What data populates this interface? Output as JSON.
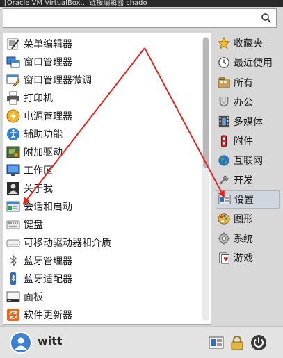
{
  "background_window": {
    "title": "[Oracle VM VirtualBox...  链接编辑器   shado"
  },
  "search": {
    "value": "",
    "placeholder": "",
    "icon": "search-icon"
  },
  "apps": [
    {
      "label": "菜单编辑器",
      "icon": "menu-editor-icon"
    },
    {
      "label": "窗口管理器",
      "icon": "window-manager-icon"
    },
    {
      "label": "窗口管理器微调",
      "icon": "window-tweaks-icon"
    },
    {
      "label": "打印机",
      "icon": "printer-icon"
    },
    {
      "label": "电源管理器",
      "icon": "power-manager-icon"
    },
    {
      "label": "辅助功能",
      "icon": "accessibility-icon"
    },
    {
      "label": "附加驱动",
      "icon": "additional-drivers-icon"
    },
    {
      "label": "工作区",
      "icon": "workspace-icon"
    },
    {
      "label": "关于我",
      "icon": "about-me-icon"
    },
    {
      "label": "会话和启动",
      "icon": "session-startup-icon"
    },
    {
      "label": "键盘",
      "icon": "keyboard-icon"
    },
    {
      "label": "可移动驱动器和介质",
      "icon": "removable-drives-icon"
    },
    {
      "label": "蓝牙管理器",
      "icon": "bluetooth-icon"
    },
    {
      "label": "蓝牙适配器",
      "icon": "bluetooth-adapter-icon"
    },
    {
      "label": "面板",
      "icon": "panel-icon"
    },
    {
      "label": "软件更新器",
      "icon": "software-updater-icon"
    }
  ],
  "categories": [
    {
      "label": "收藏夹",
      "icon": "star-icon"
    },
    {
      "label": "最近使用",
      "icon": "clock-icon"
    },
    {
      "label": "所有",
      "icon": "all-apps-icon"
    },
    {
      "label": "办公",
      "icon": "office-icon"
    },
    {
      "label": "多媒体",
      "icon": "multimedia-icon"
    },
    {
      "label": "附件",
      "icon": "accessories-icon"
    },
    {
      "label": "互联网",
      "icon": "internet-icon"
    },
    {
      "label": "开发",
      "icon": "development-icon"
    },
    {
      "label": "设置",
      "icon": "settings-icon",
      "selected": true
    },
    {
      "label": "图形",
      "icon": "graphics-icon"
    },
    {
      "label": "系统",
      "icon": "system-icon"
    },
    {
      "label": "游戏",
      "icon": "games-icon"
    }
  ],
  "user": {
    "name": "witt"
  },
  "bottom_buttons": [
    "settings-manager-icon",
    "lock-icon",
    "power-icon"
  ],
  "colors": {
    "arrow": "#e8221b",
    "avatar": "#3d7fd6",
    "selected_category": "#cfd6dd"
  }
}
